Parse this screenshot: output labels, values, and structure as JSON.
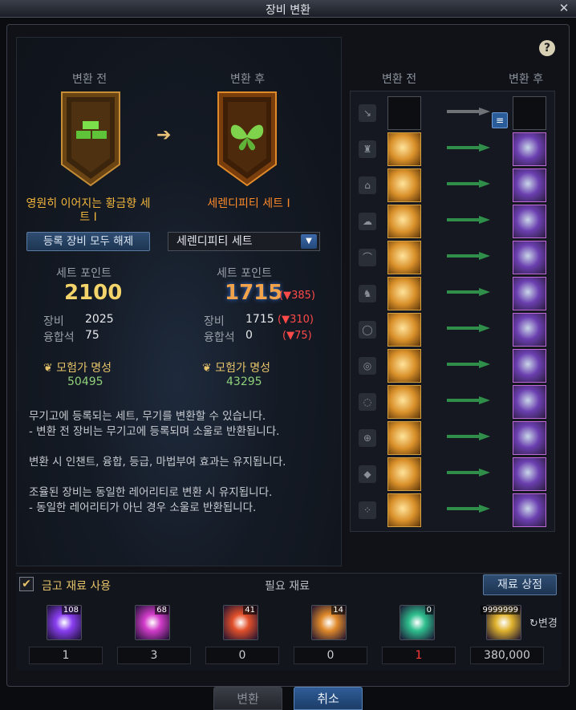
{
  "window": {
    "title": "장비 변환",
    "close_glyph": "✕",
    "help_glyph": "?"
  },
  "left": {
    "before_header": "변환 전",
    "after_header": "변환 후",
    "before_set_name": "영원히 이어지는 황금향 세트 I",
    "after_set_name": "세렌디피티 세트 I",
    "unregister_button": "등록 장비 모두 해제",
    "select_value": "세렌디피티 세트",
    "set_point_label": "세트 포인트",
    "before_points": "2100",
    "after_points": "1715",
    "after_points_diff": "(▼385)",
    "equip_label": "장비",
    "fusion_label": "융합석",
    "before_equip": "2025",
    "before_fusion": "75",
    "after_equip": "1715",
    "after_equip_diff": "(▼310)",
    "after_fusion": "0",
    "after_fusion_diff": "(▼75)",
    "fame_label": "모험가 명성",
    "before_fame": "50495",
    "after_fame": "43295",
    "description": [
      "무기고에 등록되는 세트, 무기를 변환할 수 있습니다.",
      "- 변환 전 장비는 무기고에 등록되며 소울로 반환됩니다.",
      "",
      "변환 시 인챈트, 융합, 등급, 마법부여 효과는 유지됩니다.",
      "",
      "조율된 장비는 동일한 레어리티로 변환 시 유지됩니다.",
      "- 동일한 레어리티가 아닌 경우 소울로 반환됩니다."
    ]
  },
  "right": {
    "before_header": "변환 전",
    "after_header": "변환 후",
    "slots": [
      {
        "slot": "weapon-slot-icon",
        "before": "empty",
        "after": "empty",
        "arrow": "grey"
      },
      {
        "slot": "top-slot-icon",
        "before": "gold-armor",
        "after": "dark-armor",
        "arrow": "green"
      },
      {
        "slot": "pants-slot-icon",
        "before": "gold-pants",
        "after": "dark-pants",
        "arrow": "green"
      },
      {
        "slot": "shoulder-slot-icon",
        "before": "gold-shoulder",
        "after": "feather-shoulder",
        "arrow": "green"
      },
      {
        "slot": "belt-slot-icon",
        "before": "gold-belt",
        "after": "ribbon-belt",
        "arrow": "green"
      },
      {
        "slot": "shoes-slot-icon",
        "before": "gold-shoes",
        "after": "purple-shoes",
        "arrow": "green"
      },
      {
        "slot": "necklace-slot-icon",
        "before": "gold-necklace",
        "after": "feather-necklace",
        "arrow": "green"
      },
      {
        "slot": "bracelet-slot-icon",
        "before": "gold-bracelet",
        "after": "wand-bracelet",
        "arrow": "green"
      },
      {
        "slot": "ring-slot-icon",
        "before": "gold-ring",
        "after": "chest-ring",
        "arrow": "green"
      },
      {
        "slot": "support-slot-icon",
        "before": "gold-support",
        "after": "mask-support",
        "arrow": "green"
      },
      {
        "slot": "magicstone-slot-icon",
        "before": "gold-magicstone",
        "after": "leaf-magicstone",
        "arrow": "green"
      },
      {
        "slot": "earring-slot-icon",
        "before": "gold-earring",
        "after": "wing-earring",
        "arrow": "green"
      }
    ]
  },
  "bottom": {
    "use_vault_label": "금고 재료 사용",
    "required_label": "필요 재료",
    "shop_button": "재료 상점",
    "change_label": "변경",
    "materials": [
      {
        "name": "purple-soul-icon",
        "count": "108",
        "qty": "1",
        "color": "#8a3ff2",
        "qty_red": false
      },
      {
        "name": "pink-soul-icon",
        "count": "68",
        "qty": "3",
        "color": "#d23cc9",
        "qty_red": false
      },
      {
        "name": "red-soul-icon",
        "count": "41",
        "qty": "0",
        "color": "#e2502a",
        "qty_red": false
      },
      {
        "name": "orange-soul-icon",
        "count": "14",
        "qty": "0",
        "color": "#e08a2b",
        "qty_red": false
      },
      {
        "name": "green-orb-icon",
        "count": "0",
        "qty": "1",
        "color": "#2fbf8e",
        "qty_red": true
      },
      {
        "name": "gold-coins-icon",
        "count": "9999999",
        "qty": "380,000",
        "color": "#e0b32e",
        "qty_red": false
      }
    ]
  },
  "footer": {
    "convert_button": "변환",
    "cancel_button": "취소"
  }
}
